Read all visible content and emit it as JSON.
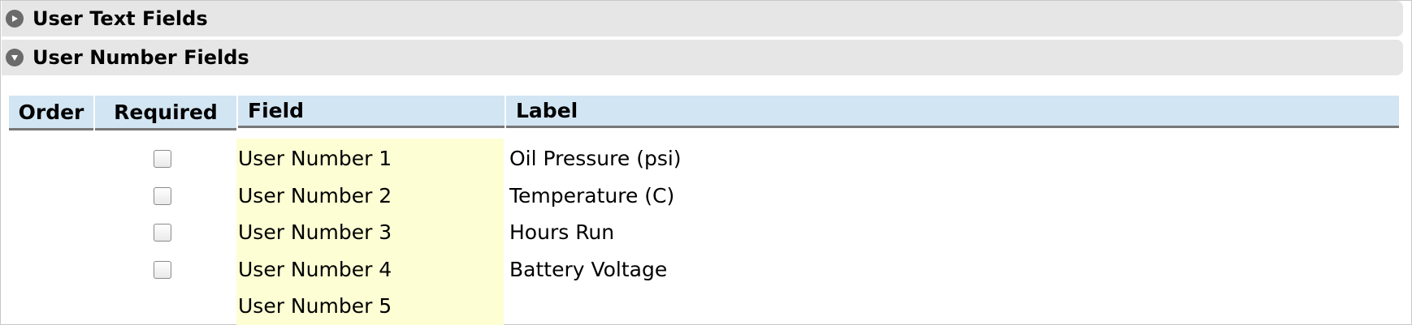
{
  "sections": {
    "text_fields": {
      "title": "User Text Fields",
      "expanded": false,
      "icon": "expand-right-icon"
    },
    "number_fields": {
      "title": "User Number Fields",
      "expanded": true,
      "icon": "collapse-down-icon"
    }
  },
  "table": {
    "headers": {
      "order": "Order",
      "required": "Required",
      "field": "Field",
      "label": "Label"
    },
    "rows": [
      {
        "required": false,
        "field": "User Number 1",
        "label": "Oil Pressure (psi)",
        "has_checkbox": true
      },
      {
        "required": false,
        "field": "User Number 2",
        "label": "Temperature (C)",
        "has_checkbox": true
      },
      {
        "required": false,
        "field": "User Number 3",
        "label": "Hours Run",
        "has_checkbox": true
      },
      {
        "required": false,
        "field": "User Number 4",
        "label": "Battery Voltage",
        "has_checkbox": true
      },
      {
        "required": false,
        "field": "User Number 5",
        "label": "",
        "has_checkbox": false
      }
    ]
  },
  "colors": {
    "header_bg": "#d2e5f3",
    "field_bg": "#fefed4",
    "section_bg": "#e6e6e6"
  }
}
